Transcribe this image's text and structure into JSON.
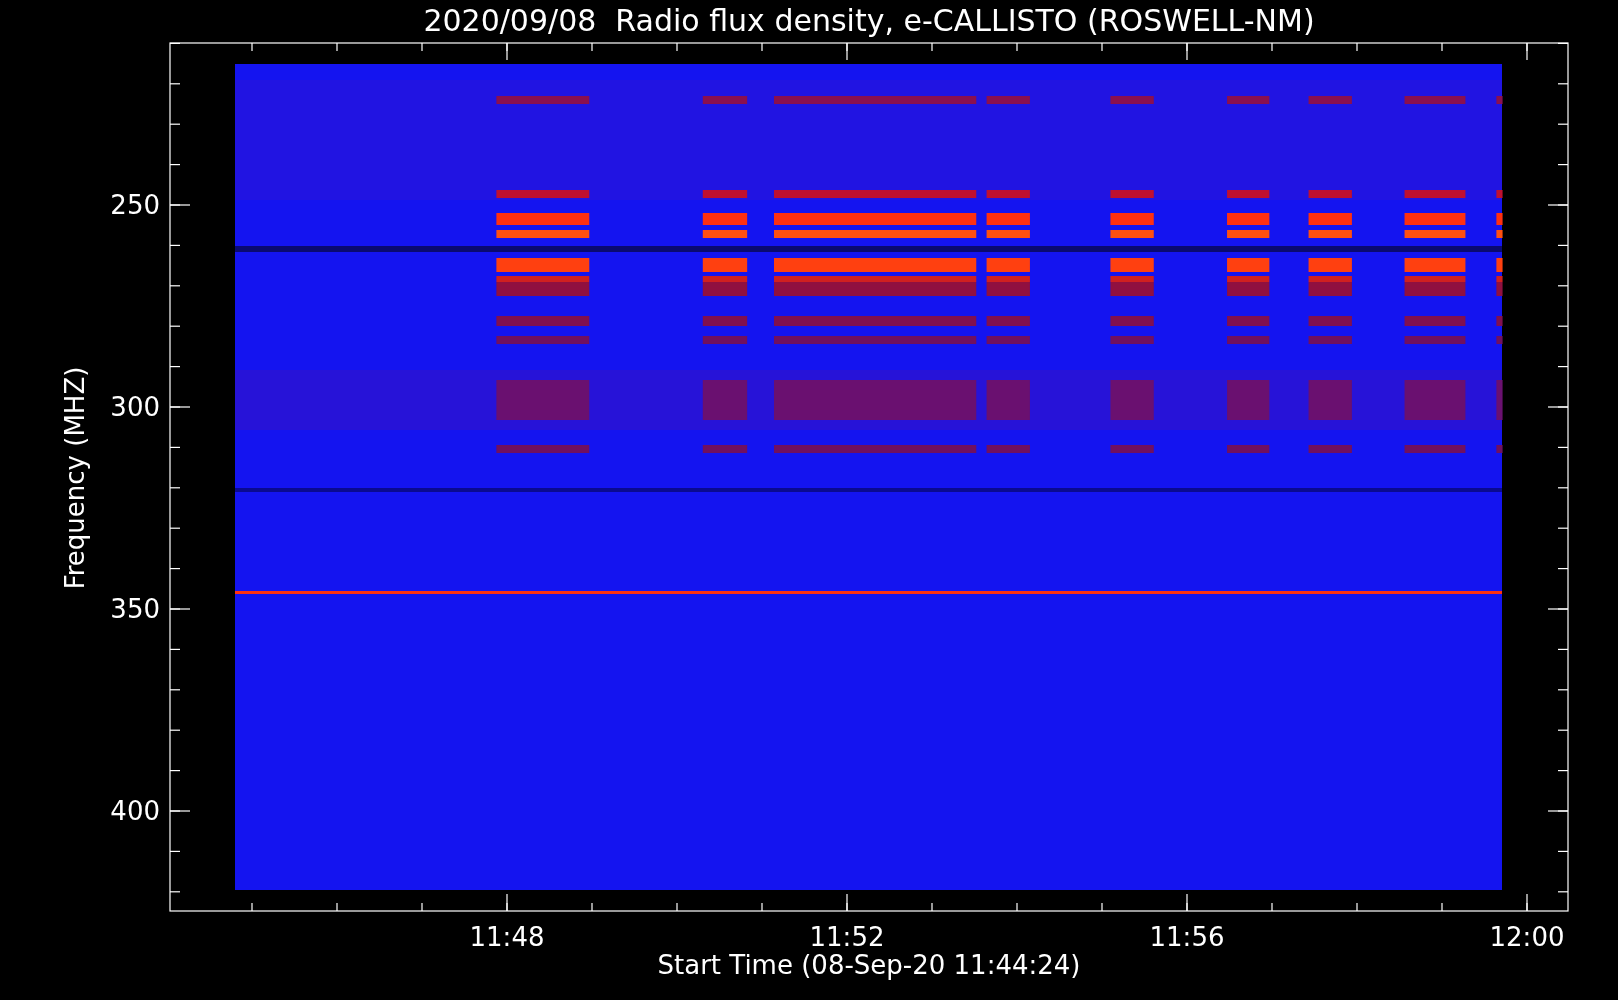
{
  "title": "2020/09/08  Radio flux density, e-CALLISTO (ROSWELL-NM)",
  "y_axis": {
    "label": "Frequency (MHZ)",
    "ticks": [
      "250",
      "300",
      "350",
      "400"
    ]
  },
  "x_axis": {
    "label": "Start Time (08-Sep-20 11:44:24)",
    "ticks": [
      "11:48",
      "11:52",
      "11:56",
      "12:00"
    ]
  }
}
